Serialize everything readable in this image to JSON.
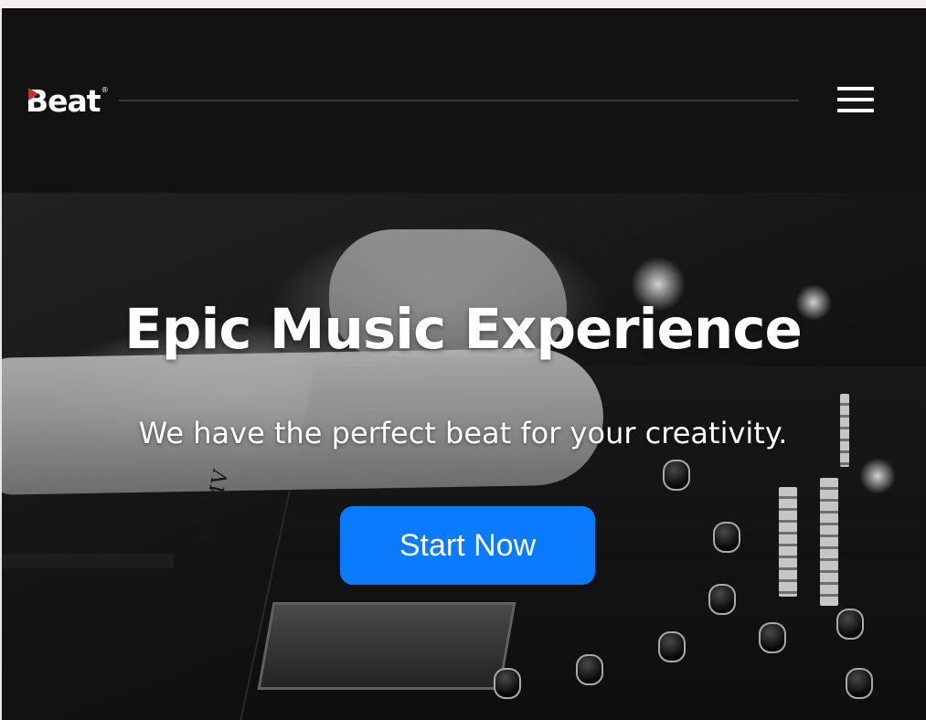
{
  "header": {
    "logo_text": "Beat",
    "logo_registered": "®",
    "logo_accent_color": "#e0252a",
    "menu_icon": "hamburger-menu-icon"
  },
  "hero": {
    "title": "Epic Music Experience",
    "subtitle": "We have the perfect beat for your creativity.",
    "cta_label": "Start Now",
    "cta_color": "#0a7bff",
    "background_image": "black-and-white DJ mixer with hands"
  },
  "colors": {
    "page_background": "#121212",
    "text": "#ffffff"
  }
}
